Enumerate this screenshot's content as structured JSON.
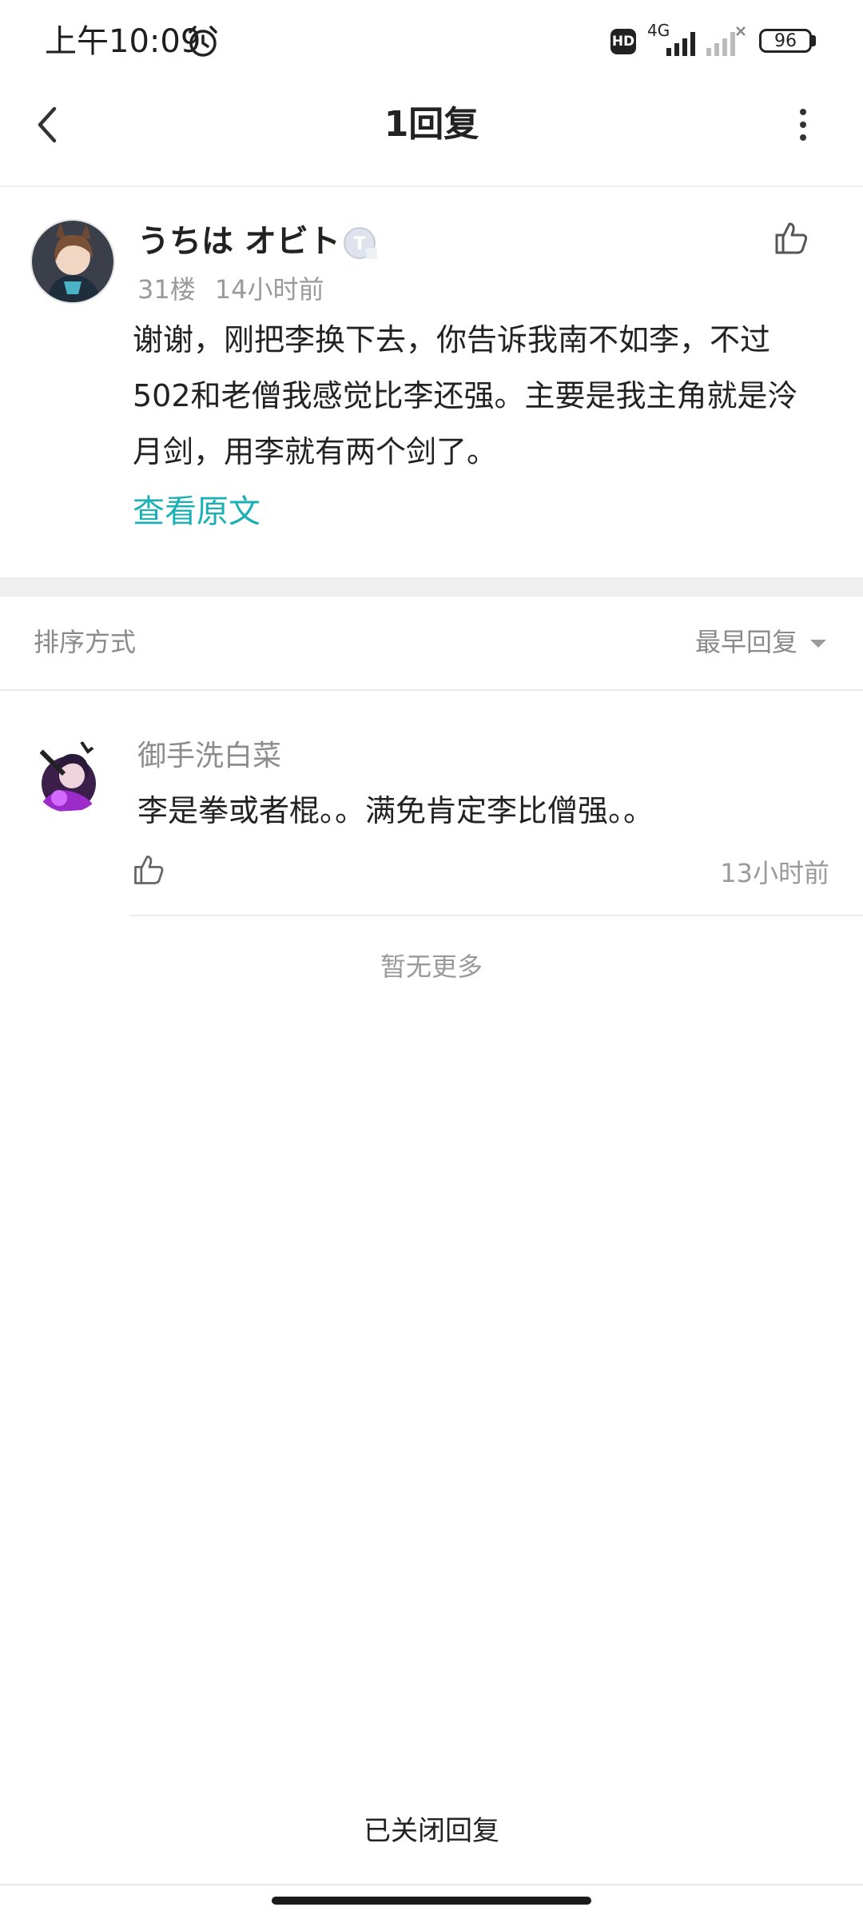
{
  "status_bar": {
    "time": "上午10:09",
    "hd": "HD",
    "network": "4G",
    "battery": "96"
  },
  "header": {
    "title": "1回复"
  },
  "post": {
    "author": "うちは オビト",
    "level_badge": "T",
    "floor": "31楼",
    "time": "14小时前",
    "body": "谢谢，刚把李换下去，你告诉我南不如李，不过502和老僧我感觉比李还强。主要是我主角就是泠月剑，用李就有两个剑了。",
    "view_original": "查看原文"
  },
  "sort": {
    "label": "排序方式",
    "value": "最早回复"
  },
  "replies": [
    {
      "author": "御手洗白菜",
      "body": "李是拳或者棍。。满免肯定李比僧强。。",
      "time": "13小时前"
    }
  ],
  "no_more": "暂无更多",
  "footer": {
    "closed": "已关闭回复"
  },
  "colors": {
    "accent": "#1ab0b6",
    "muted": "#9a9a9a"
  }
}
